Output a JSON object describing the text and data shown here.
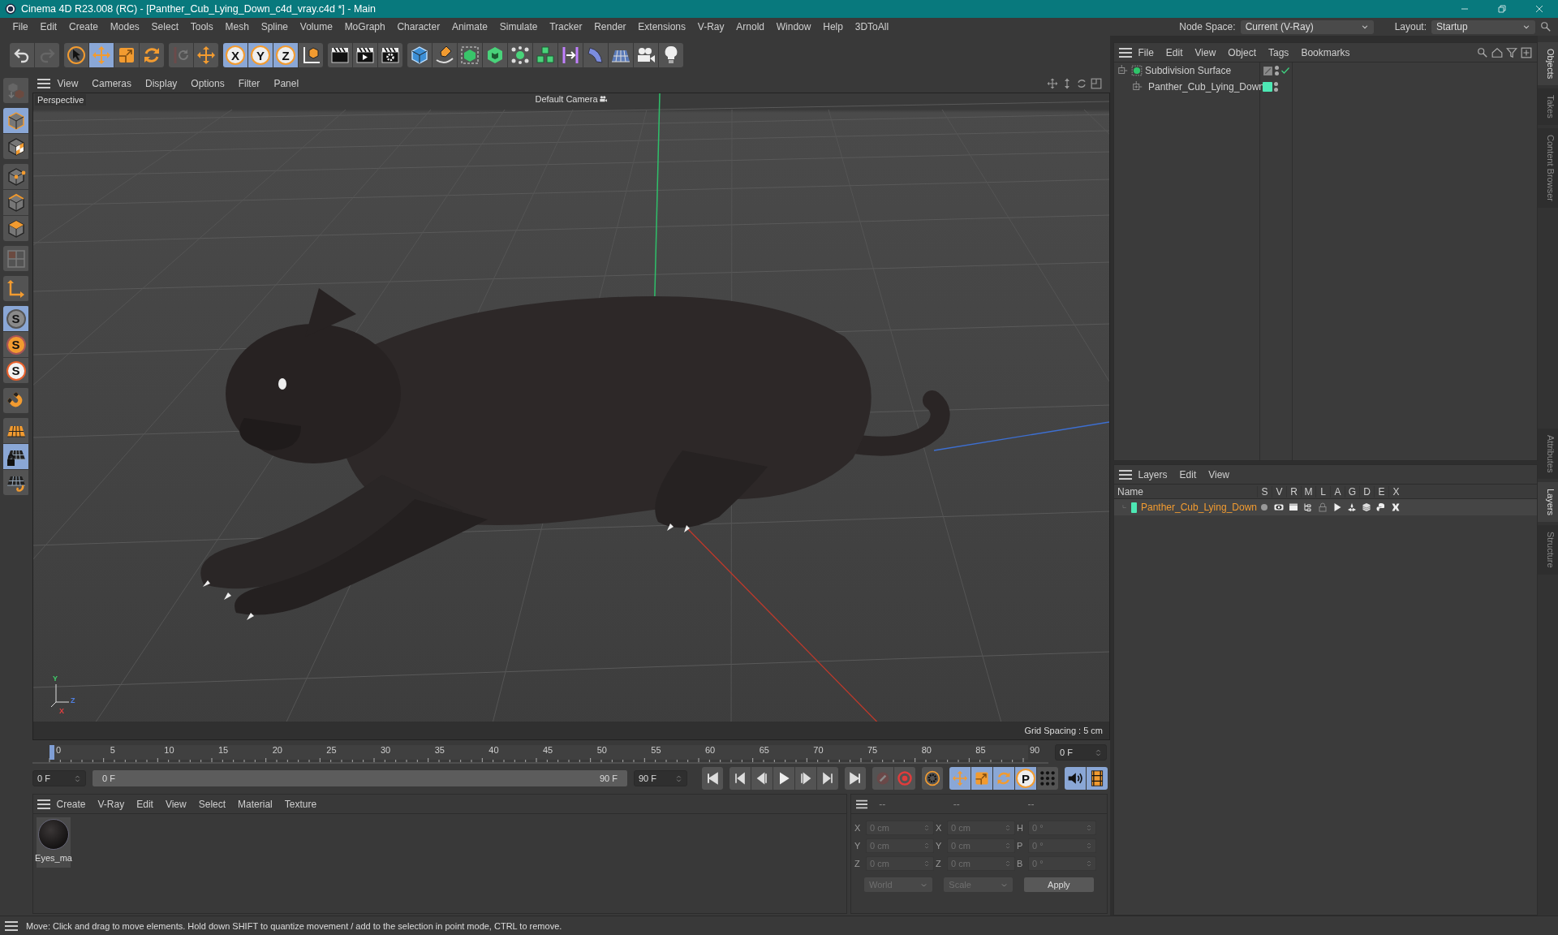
{
  "window": {
    "title": "Cinema 4D R23.008 (RC) - [Panther_Cub_Lying_Down_c4d_vray.c4d *] - Main"
  },
  "menu_bar": [
    "File",
    "Edit",
    "Create",
    "Modes",
    "Select",
    "Tools",
    "Mesh",
    "Spline",
    "Volume",
    "MoGraph",
    "Character",
    "Animate",
    "Simulate",
    "Tracker",
    "Render",
    "Extensions",
    "V-Ray",
    "Arnold",
    "Window",
    "Help",
    "3DToAll"
  ],
  "node_space": {
    "label": "Node Space:",
    "value": "Current (V-Ray)"
  },
  "layout": {
    "label": "Layout:",
    "value": "Startup"
  },
  "toolbar": [
    [
      {
        "kind": "undo",
        "selected": false
      },
      {
        "kind": "redo",
        "selected": false
      }
    ],
    [
      {
        "kind": "select",
        "selected": false
      },
      {
        "kind": "move",
        "selected": true
      },
      {
        "kind": "scale",
        "selected": false
      },
      {
        "kind": "rotate",
        "selected": false
      }
    ],
    [
      {
        "kind": "psr",
        "selected": false
      },
      {
        "kind": "move",
        "selected": false
      }
    ],
    [
      {
        "kind": "axis",
        "label": "X",
        "selected": true
      },
      {
        "kind": "axis",
        "label": "Y",
        "selected": true
      },
      {
        "kind": "axis",
        "label": "Z",
        "selected": true
      },
      {
        "kind": "coord",
        "selected": false
      }
    ],
    [
      {
        "kind": "clap",
        "selected": false
      },
      {
        "kind": "clap_play",
        "selected": false
      },
      {
        "kind": "clap_gear",
        "selected": false
      }
    ],
    [
      {
        "kind": "cube",
        "selected": false
      },
      {
        "kind": "pen",
        "selected": false
      },
      {
        "kind": "subdiv",
        "selected": false
      },
      {
        "kind": "extrude",
        "selected": false
      },
      {
        "kind": "cloner",
        "selected": false
      },
      {
        "kind": "array",
        "selected": false
      },
      {
        "kind": "symmetry",
        "selected": false
      },
      {
        "kind": "bend",
        "selected": false
      },
      {
        "kind": "floor",
        "selected": false
      },
      {
        "kind": "camera",
        "selected": false
      },
      {
        "kind": "light",
        "selected": false
      }
    ]
  ],
  "side_toolbar": [
    [
      {
        "kind": "model",
        "selected": false
      }
    ],
    [
      {
        "kind": "object",
        "selected": true
      },
      {
        "kind": "texture",
        "selected": false
      }
    ],
    [
      {
        "kind": "points",
        "selected": false
      },
      {
        "kind": "edges",
        "selected": false
      },
      {
        "kind": "polys",
        "selected": false
      }
    ],
    [
      {
        "kind": "uv",
        "selected": false
      }
    ],
    [
      {
        "kind": "axis_tool",
        "selected": false
      }
    ],
    [
      {
        "kind": "snap_grey",
        "label": "S",
        "selected": true
      },
      {
        "kind": "snap_orange",
        "label": "S",
        "selected": false
      },
      {
        "kind": "snap_white",
        "label": "S",
        "selected": false
      }
    ],
    [
      {
        "kind": "magnet",
        "selected": false
      }
    ],
    [
      {
        "kind": "plane",
        "selected": false
      },
      {
        "kind": "plane_lock",
        "selected": true
      },
      {
        "kind": "plane_rotate",
        "selected": false
      }
    ]
  ],
  "viewport": {
    "menu": [
      "View",
      "Cameras",
      "Display",
      "Options",
      "Filter",
      "Panel"
    ],
    "view_name": "Perspective",
    "camera": "Default Camera",
    "grid_spacing": "Grid Spacing : 5 cm",
    "axis_labels": [
      "Y",
      "Z",
      "X"
    ]
  },
  "timeline": {
    "ticks": [
      "0",
      "5",
      "10",
      "15",
      "20",
      "25",
      "30",
      "35",
      "40",
      "45",
      "50",
      "55",
      "60",
      "65",
      "70",
      "75",
      "80",
      "85",
      "90"
    ],
    "playhead": {
      "level": 0
    },
    "current_frame": "0 F",
    "start_field": "0 F",
    "range": {
      "level": 1,
      "start": "0 F",
      "end": "90 F"
    },
    "end_field": "90 F",
    "buttons": [
      [
        {
          "kind": "first",
          "selected": false
        }
      ],
      [
        {
          "kind": "prevkey",
          "selected": false
        },
        {
          "kind": "stepback",
          "selected": false
        },
        {
          "kind": "play",
          "selected": false
        },
        {
          "kind": "stepfwd",
          "selected": false
        },
        {
          "kind": "nextkey",
          "selected": false
        }
      ],
      [
        {
          "kind": "last",
          "selected": false
        }
      ],
      [
        {
          "kind": "record",
          "selected": false
        },
        {
          "kind": "autokey",
          "selected": false
        }
      ],
      [
        {
          "kind": "keyset",
          "selected": false
        }
      ],
      [
        {
          "kind": "move",
          "selected": true
        },
        {
          "kind": "scale",
          "selected": true
        },
        {
          "kind": "rotate",
          "selected": true
        },
        {
          "kind": "param",
          "label": "P",
          "selected": true
        },
        {
          "kind": "pla",
          "selected": false
        }
      ],
      [
        {
          "kind": "sound",
          "selected": true
        },
        {
          "kind": "film",
          "selected": true
        }
      ]
    ]
  },
  "material_panel": {
    "menu": [
      "Create",
      "V-Ray",
      "Edit",
      "View",
      "Select",
      "Material",
      "Texture"
    ],
    "materials": [
      {
        "name": "Eyes_ma"
      }
    ]
  },
  "coordinates": {
    "headers": [
      "--",
      "--",
      "--"
    ],
    "disabled": true,
    "rows": [
      {
        "label_1": "X",
        "value_1": "0 cm",
        "label_2": "X",
        "value_2": "0 cm",
        "label_3": "H",
        "value_3": "0 °"
      },
      {
        "label_1": "Y",
        "value_1": "0 cm",
        "label_2": "Y",
        "value_2": "0 cm",
        "label_3": "P",
        "value_3": "0 °"
      },
      {
        "label_1": "Z",
        "value_1": "0 cm",
        "label_2": "Z",
        "value_2": "0 cm",
        "label_3": "B",
        "value_3": "0 °"
      }
    ],
    "dropdowns": [
      "World",
      "Scale"
    ],
    "apply": "Apply"
  },
  "objects_panel": {
    "menu": [
      "File",
      "Edit",
      "View",
      "Object",
      "Tags",
      "Bookmarks"
    ],
    "tree": [
      {
        "name": "Subdivision Surface",
        "kind": "subdivision",
        "expanded": true,
        "enabled": true,
        "children": [
          {
            "name": "Panther_Cub_Lying_Down",
            "kind": "null",
            "expanded": false,
            "color": "#4de8b4"
          }
        ]
      }
    ]
  },
  "layers_panel": {
    "menu": [
      "Layers",
      "Edit",
      "View"
    ],
    "columns": [
      "Name",
      "S",
      "V",
      "R",
      "M",
      "L",
      "A",
      "G",
      "D",
      "E",
      "X"
    ],
    "rows": [
      {
        "name": "Panther_Cub_Lying_Down",
        "color": "#4de8b4"
      }
    ]
  },
  "side_tabs_top": [
    {
      "label": "Objects",
      "selected": true
    },
    {
      "label": "Takes",
      "selected": false
    },
    {
      "label": "Content Browser",
      "selected": false
    }
  ],
  "side_tabs_bottom": [
    {
      "label": "Attributes",
      "selected": false
    },
    {
      "label": "Layers",
      "selected": true
    },
    {
      "label": "Structure",
      "selected": false
    }
  ],
  "status_bar": "Move: Click and drag to move elements. Hold down SHIFT to quantize movement / add to the selection in point mode, CTRL to remove."
}
